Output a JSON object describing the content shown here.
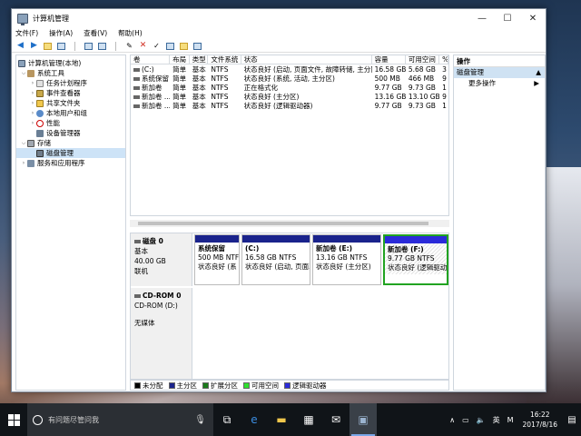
{
  "window": {
    "title": "计算机管理"
  },
  "window_controls": {
    "minimize": "—",
    "maximize": "☐",
    "close": "✕"
  },
  "menu": [
    "文件(F)",
    "操作(A)",
    "查看(V)",
    "帮助(H)"
  ],
  "tree": {
    "root": "计算机管理(本地)",
    "system_tools": "系统工具",
    "task_scheduler": "任务计划程序",
    "event_viewer": "事件查看器",
    "shared_folders": "共享文件夹",
    "local_users": "本地用户和组",
    "performance": "性能",
    "device_manager": "设备管理器",
    "storage": "存储",
    "disk_management": "磁盘管理",
    "services": "服务和应用程序"
  },
  "volume_table": {
    "headers": [
      "卷",
      "布局",
      "类型",
      "文件系统",
      "状态",
      "容量",
      "可用空间",
      "%"
    ],
    "rows": [
      [
        "(C:)",
        "简单",
        "基本",
        "NTFS",
        "状态良好 (启动, 页面文件, 故障转储, 主分区)",
        "16.58 GB",
        "5.68 GB",
        "3"
      ],
      [
        "系统保留",
        "简单",
        "基本",
        "NTFS",
        "状态良好 (系统, 活动, 主分区)",
        "500 MB",
        "466 MB",
        "9"
      ],
      [
        "新加卷",
        "简单",
        "基本",
        "NTFS",
        "正在格式化",
        "9.77 GB",
        "9.73 GB",
        "1"
      ],
      [
        "新加卷 ...",
        "简单",
        "基本",
        "NTFS",
        "状态良好 (主分区)",
        "13.16 GB",
        "13.10 GB",
        "9"
      ],
      [
        "新加卷 ...",
        "简单",
        "基本",
        "NTFS",
        "状态良好 (逻辑驱动器)",
        "9.77 GB",
        "9.73 GB",
        "1"
      ]
    ]
  },
  "disk0": {
    "name": "磁盘 0",
    "type": "基本",
    "size": "40.00 GB",
    "status": "联机",
    "partitions": [
      {
        "name": "系统保留",
        "size": "500 MB NTF",
        "status": "状态良好 (系",
        "bar": "primary"
      },
      {
        "name": "(C:)",
        "size": "16.58 GB NTFS",
        "status": "状态良好 (启动, 页面3",
        "bar": "primary"
      },
      {
        "name": "新加卷 (E:)",
        "size": "13.16 GB NTFS",
        "status": "状态良好 (主分区)",
        "bar": "primary"
      },
      {
        "name": "新加卷 (F:)",
        "size": "9.77 GB NTFS",
        "status": "状态良好 (逻辑驱动",
        "bar": "logical"
      }
    ]
  },
  "cdrom0": {
    "name": "CD-ROM 0",
    "drive": "CD-ROM (D:)",
    "status": "无媒体"
  },
  "legend": [
    {
      "label": "未分配",
      "color": "#000000"
    },
    {
      "label": "主分区",
      "color": "#1a238c"
    },
    {
      "label": "扩展分区",
      "color": "#1a7a1a"
    },
    {
      "label": "可用空间",
      "color": "#2ee02e"
    },
    {
      "label": "逻辑驱动器",
      "color": "#2b2bd9"
    }
  ],
  "actions": {
    "header": "操作",
    "section": "磁盘管理",
    "more": "更多操作"
  },
  "taskbar": {
    "search_placeholder": "有问题尽管问我",
    "ime": "英",
    "ime2": "M",
    "time": "16:22",
    "date": "2017/8/16"
  },
  "colors": {
    "accent": "#1e6fc8",
    "primary_partition": "#1a238c",
    "logical_partition": "#2b2bd9",
    "selection": "#21a321"
  }
}
